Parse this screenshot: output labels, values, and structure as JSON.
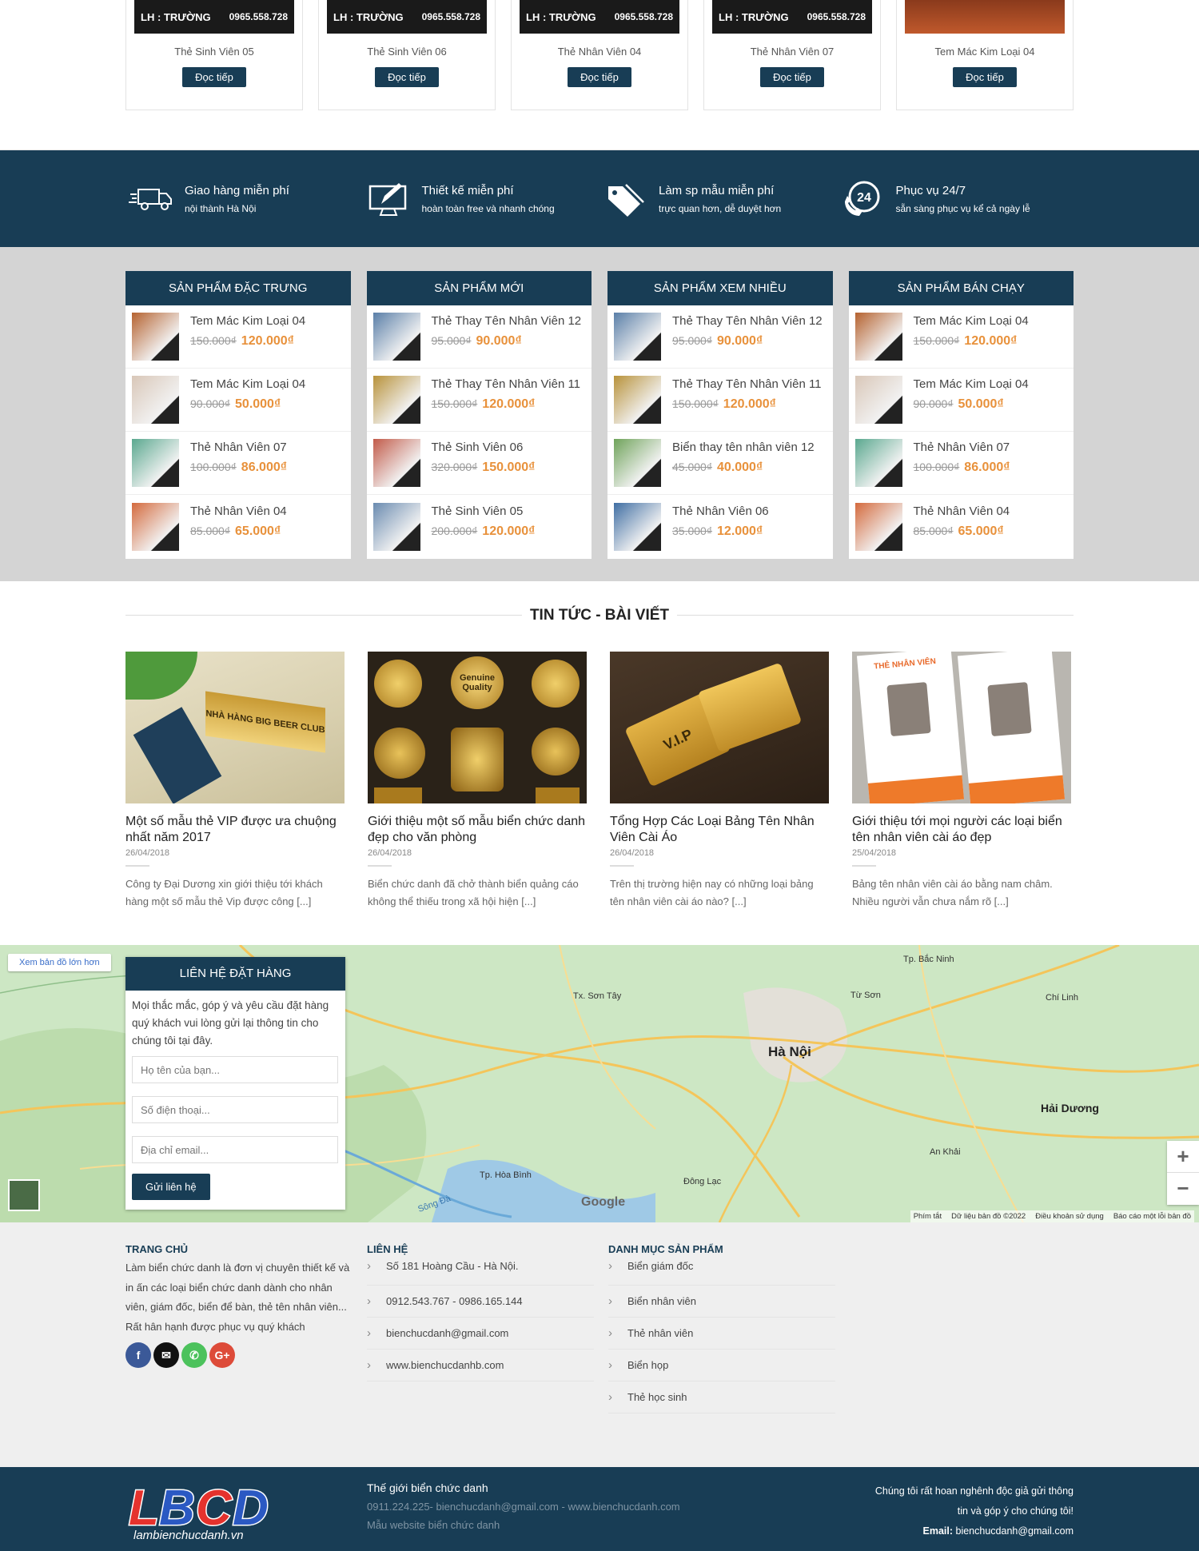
{
  "top_products": [
    {
      "name": "Thẻ Sinh Viên 05",
      "img_text": "LH : TRƯỜNG",
      "img_phone": "0965.558.728",
      "button": "Đọc tiếp"
    },
    {
      "name": "Thẻ Sinh Viên 06",
      "img_text": "LH : TRƯỜNG",
      "img_phone": "0965.558.728",
      "button": "Đọc tiếp"
    },
    {
      "name": "Thẻ Nhân Viên 04",
      "img_text": "LH : TRƯỜNG",
      "img_phone": "0965.558.728",
      "button": "Đọc tiếp"
    },
    {
      "name": "Thẻ Nhân Viên 07",
      "img_text": "LH : TRƯỜNG",
      "img_phone": "0965.558.728",
      "button": "Đọc tiếp"
    },
    {
      "name": "Tem Mác Kim Loại 04",
      "img_text": "",
      "img_phone": "",
      "button": "Đọc tiếp"
    }
  ],
  "features": [
    {
      "icon": "truck-icon",
      "title": "Giao hàng miễn phí",
      "sub": "nội thành Hà Nội"
    },
    {
      "icon": "monitor-pen-icon",
      "title": "Thiết kế miễn phí",
      "sub": "hoàn toàn free và nhanh chóng"
    },
    {
      "icon": "tag-icon",
      "title": "Làm sp mẫu miễn phí",
      "sub": "trực quan hơn, dễ duyệt hơn"
    },
    {
      "icon": "phone-24-icon",
      "title": "Phục vụ 24/7",
      "sub": "sẵn sàng phục vụ kể cả ngày lễ"
    }
  ],
  "product_columns": [
    {
      "title": "SẢN PHẨM ĐẶC TRƯNG",
      "items": [
        {
          "name": "Tem Mác Kim Loại 04",
          "old": "150.000₫",
          "new": "120.000₫",
          "thumb": "#b5622f"
        },
        {
          "name": "Tem Mác Kim Loại 04",
          "old": "90.000₫",
          "new": "50.000₫",
          "thumb": "#d9c7b8"
        },
        {
          "name": "Thẻ Nhân Viên 07",
          "old": "100.000₫",
          "new": "86.000₫",
          "thumb": "#5aa88f"
        },
        {
          "name": "Thẻ Nhân Viên 04",
          "old": "85.000₫",
          "new": "65.000₫",
          "thumb": "#d46a3d"
        }
      ]
    },
    {
      "title": "SẢN PHẨM MỚI",
      "items": [
        {
          "name": "Thẻ Thay Tên Nhân Viên 12",
          "old": "95.000₫",
          "new": "90.000₫",
          "thumb": "#5a7fa8"
        },
        {
          "name": "Thẻ Thay Tên Nhân Viên 11",
          "old": "150.000₫",
          "new": "120.000₫",
          "thumb": "#b8923a"
        },
        {
          "name": "Thẻ Sinh Viên 06",
          "old": "320.000₫",
          "new": "150.000₫",
          "thumb": "#c25b4a"
        },
        {
          "name": "Thẻ Sinh Viên 05",
          "old": "200.000₫",
          "new": "120.000₫",
          "thumb": "#6a8bb0"
        }
      ]
    },
    {
      "title": "SẢN PHẨM XEM NHIỀU",
      "items": [
        {
          "name": "Thẻ Thay Tên Nhân Viên 12",
          "old": "95.000₫",
          "new": "90.000₫",
          "thumb": "#5a7fa8"
        },
        {
          "name": "Thẻ Thay Tên Nhân Viên 11",
          "old": "150.000₫",
          "new": "120.000₫",
          "thumb": "#b8923a"
        },
        {
          "name": "Biển thay tên nhân viên 12",
          "old": "45.000₫",
          "new": "40.000₫",
          "thumb": "#6fa35a"
        },
        {
          "name": "Thẻ Nhân Viên 06",
          "old": "35.000₫",
          "new": "12.000₫",
          "thumb": "#3f6ea3"
        }
      ]
    },
    {
      "title": "SẢN PHẨM BÁN CHẠY",
      "items": [
        {
          "name": "Tem Mác Kim Loại 04",
          "old": "150.000₫",
          "new": "120.000₫",
          "thumb": "#b5622f"
        },
        {
          "name": "Tem Mác Kim Loại 04",
          "old": "90.000₫",
          "new": "50.000₫",
          "thumb": "#d9c7b8"
        },
        {
          "name": "Thẻ Nhân Viên 07",
          "old": "100.000₫",
          "new": "86.000₫",
          "thumb": "#5aa88f"
        },
        {
          "name": "Thẻ Nhân Viên 04",
          "old": "85.000₫",
          "new": "65.000₫",
          "thumb": "#d46a3d"
        }
      ]
    }
  ],
  "news": {
    "title": "TIN TỨC - BÀI VIẾT",
    "items": [
      {
        "title": "Một số mẫu thẻ VIP được ưa chuộng nhất năm 2017",
        "date": "26/04/2018",
        "excerpt": "Công ty Đại Dương xin giới thiệu tới khách hàng một số mẫu thẻ Vip được công [...]",
        "img_label": "NHÀ HÀNG BIG BEER CLUB"
      },
      {
        "title": "Giới thiệu một số mẫu biển chức danh đẹp cho văn phòng",
        "date": "26/04/2018",
        "excerpt": "Biển chức danh đã chở thành biển quảng cáo không thể thiếu trong xã hội hiện [...]",
        "img_label": "Genuine Quality"
      },
      {
        "title": "Tổng Hợp Các Loại Bảng Tên Nhân Viên Cài Áo",
        "date": "26/04/2018",
        "excerpt": "Trên thị trường hiện nay có những loại bảng tên nhân viên cài áo nào? [...]",
        "img_label": "V.I.P"
      },
      {
        "title": "Giới thiệu tới mọi người các loại biển tên nhân viên cài áo đẹp",
        "date": "25/04/2018",
        "excerpt": "Bảng tên nhân viên cài áo bằng nam châm. Nhiều người vẫn chưa nắm rõ [...]",
        "img_label": "THẺ NHÂN VIÊN"
      }
    ]
  },
  "map": {
    "link": "Xem bản đồ lớn hơn",
    "labels": {
      "hanoi": "Hà Nội",
      "haiduong": "Hải Dương",
      "sontay": "Tx. Sơn Tây",
      "hoabinh": "Tp. Hòa Bình",
      "bacninh": "Tp. Bắc Ninh",
      "tuson": "Từ Sơn",
      "chilinh": "Chí Linh",
      "dongluc": "Đông Lạc",
      "ankhai": "An Khải",
      "songda": "Sông Đà"
    },
    "google": "Google",
    "zoom_in": "+",
    "zoom_out": "−",
    "footer": [
      "Phím tắt",
      "Dữ liệu bản đồ ©2022",
      "Điều khoản sử dụng",
      "Báo cáo một lỗi bản đồ"
    ]
  },
  "contact": {
    "title": "LIÊN HỆ ĐẶT HÀNG",
    "intro": "Mọi thắc mắc, góp ý và yêu cầu đặt hàng quý khách vui lòng gửi lại thông tin cho chúng tôi tại đây.",
    "name_ph": "Họ tên của bạn...",
    "phone_ph": "Số điện thoại...",
    "email_ph": "Địa chỉ email...",
    "send": "Gửi liên hệ"
  },
  "footer": {
    "home_title": "TRANG CHỦ",
    "home_text": "Làm biển chức danh là đơn vị chuyên thiết kế và in ấn các loại biển chức danh dành cho nhân viên, giám đốc, biển để bàn, thẻ tên nhân viên... Rất hân hạnh được phục vụ quý khách",
    "contact_title": "LIÊN HỆ",
    "contact_items": [
      "Số 181 Hoàng Cầu - Hà Nội.",
      "0912.543.767 - 0986.165.144",
      "bienchucdanh@gmail.com",
      "www.bienchucdanhb.com"
    ],
    "cat_title": "DANH MỤC SẢN PHẨM",
    "cat_items": [
      "Biển giám đốc",
      "Biển nhân viên",
      "Thẻ nhân viên",
      "Biển họp",
      "Thẻ học sinh"
    ],
    "social": [
      {
        "icon": "facebook-icon",
        "glyph": "f",
        "color": "#3b5998"
      },
      {
        "icon": "email-icon",
        "glyph": "✉",
        "color": "#111111"
      },
      {
        "icon": "phone-icon",
        "glyph": "✆",
        "color": "#4cc25c"
      },
      {
        "icon": "google-plus-icon",
        "glyph": "G+",
        "color": "#dd4b39"
      }
    ]
  },
  "bottom": {
    "logo_text": "LBCD",
    "logo_sub": "lambienchucdanh.vn",
    "title": "Thế giới biển chức danh",
    "contact": "0911.224.225- bienchucdanh@gmail.com - www.bienchucdanh.com",
    "template": "Mẫu website biển chức danh",
    "right1": "Chúng tôi rất hoan nghênh độc giả gửi thông",
    "right2": "tin và góp ý cho chúng tôi!",
    "email_label": "Email:",
    "email": "bienchucdanh@gmail.com"
  },
  "colors": {
    "primary": "#183d55",
    "price": "#e8913b"
  }
}
